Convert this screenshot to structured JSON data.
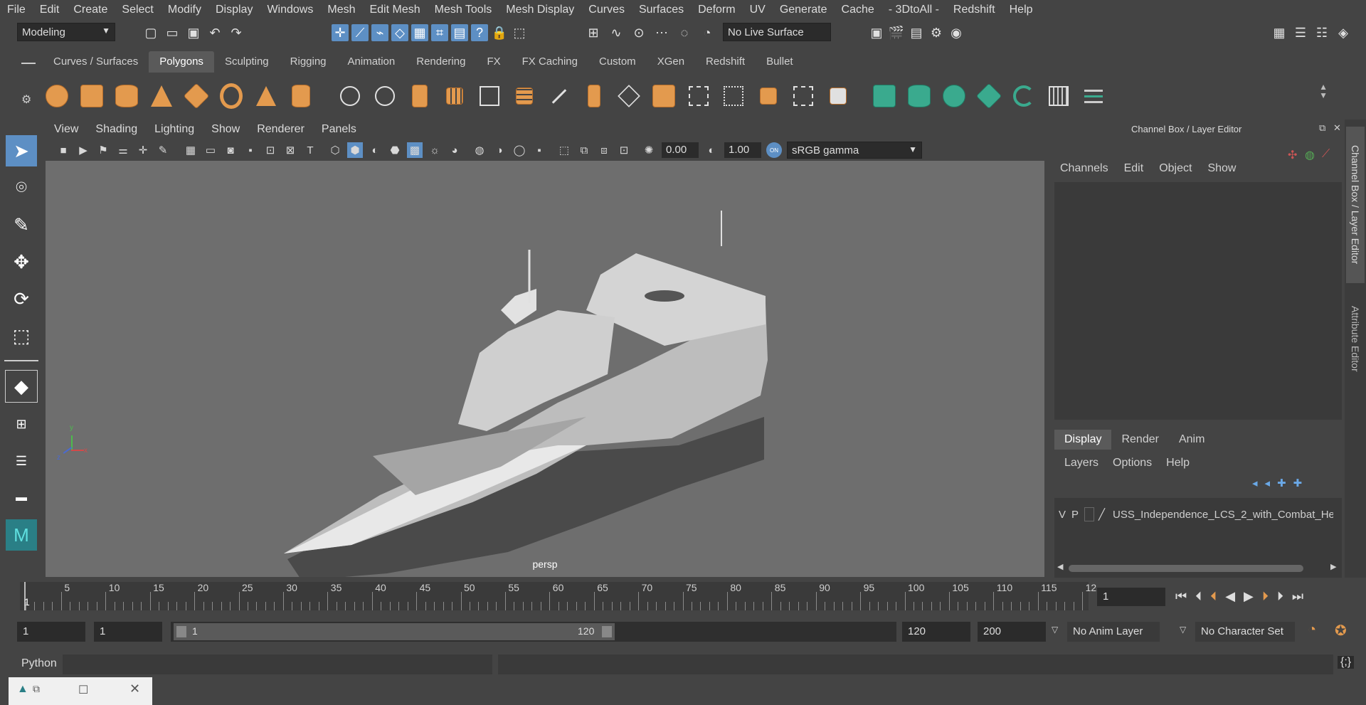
{
  "menubar": [
    "File",
    "Edit",
    "Create",
    "Select",
    "Modify",
    "Display",
    "Windows",
    "Mesh",
    "Edit Mesh",
    "Mesh Tools",
    "Mesh Display",
    "Curves",
    "Surfaces",
    "Deform",
    "UV",
    "Generate",
    "Cache",
    "- 3DtoAll -",
    "Redshift",
    "Help"
  ],
  "status": {
    "mode": "Modeling",
    "live_surface": "No Live Surface"
  },
  "shelf_tabs": [
    "Curves / Surfaces",
    "Polygons",
    "Sculpting",
    "Rigging",
    "Animation",
    "Rendering",
    "FX",
    "FX Caching",
    "Custom",
    "XGen",
    "Redshift",
    "Bullet"
  ],
  "shelf_active": "Polygons",
  "viewport": {
    "menu": [
      "View",
      "Shading",
      "Lighting",
      "Show",
      "Renderer",
      "Panels"
    ],
    "exposure": "0.00",
    "gamma": "1.00",
    "color_space": "sRGB gamma",
    "camera_label": "persp",
    "axis_y": "y",
    "axis_x": "x",
    "axis_z": "z"
  },
  "channel_box": {
    "title": "Channel Box / Layer Editor",
    "menu": [
      "Channels",
      "Edit",
      "Object",
      "Show"
    ],
    "layer_tabs": [
      "Display",
      "Render",
      "Anim"
    ],
    "layer_menu": [
      "Layers",
      "Options",
      "Help"
    ],
    "layer": {
      "v": "V",
      "p": "P",
      "name": "USS_Independence_LCS_2_with_Combat_He"
    }
  },
  "side_tabs": {
    "channel": "Channel Box / Layer Editor",
    "attribute": "Attribute Editor"
  },
  "timeline": {
    "ticks": [
      "5",
      "10",
      "15",
      "20",
      "25",
      "30",
      "35",
      "40",
      "45",
      "50",
      "55",
      "60",
      "65",
      "70",
      "75",
      "80",
      "85",
      "90",
      "95",
      "100",
      "105",
      "110",
      "115",
      "12"
    ],
    "current_frame": "1",
    "frame_field": "1"
  },
  "range": {
    "start": "1",
    "playback_start": "1",
    "slider_start": "1",
    "slider_end": "120",
    "playback_end": "120",
    "end": "200",
    "anim_layer": "No Anim Layer",
    "character_set": "No Character Set"
  },
  "cmdline": {
    "label": "Python"
  }
}
